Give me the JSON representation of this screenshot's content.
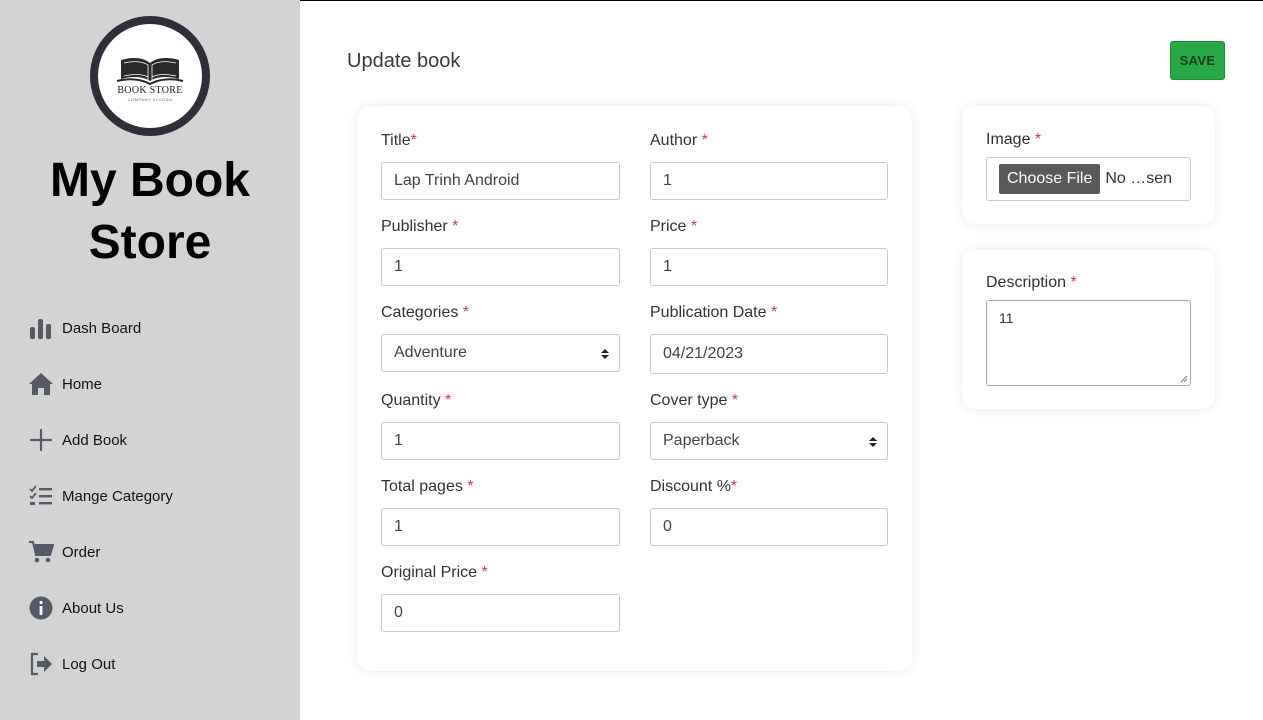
{
  "sidebar": {
    "logo": {
      "text": "BOOK STORE",
      "slogan": "COMPANY SLOGAN"
    },
    "brand": "My Book Store",
    "items": [
      {
        "label": "Dash Board",
        "icon": "bar-chart-icon"
      },
      {
        "label": "Home",
        "icon": "home-icon"
      },
      {
        "label": "Add Book",
        "icon": "plus-icon"
      },
      {
        "label": "Mange Category",
        "icon": "checklist-icon"
      },
      {
        "label": "Order",
        "icon": "cart-icon"
      },
      {
        "label": "About Us",
        "icon": "info-icon"
      },
      {
        "label": "Log Out",
        "icon": "logout-icon"
      }
    ]
  },
  "header": {
    "title": "Update book",
    "save_label": "SAVE"
  },
  "form": {
    "title": {
      "label": "Title",
      "value": "Lap Trinh Android"
    },
    "author": {
      "label": "Author ",
      "value": "1"
    },
    "publisher": {
      "label": "Publisher ",
      "value": "1"
    },
    "price": {
      "label": "Price ",
      "value": "1"
    },
    "categories": {
      "label": "Categories ",
      "value": "Adventure"
    },
    "publication_date": {
      "label": "Publication Date ",
      "value": "04/21/2023"
    },
    "quantity": {
      "label": "Quantity ",
      "value": "1"
    },
    "cover_type": {
      "label": "Cover type ",
      "value": "Paperback"
    },
    "total_pages": {
      "label": "Total pages ",
      "value": "1"
    },
    "discount": {
      "label": "Discount %",
      "value": "0"
    },
    "original_price": {
      "label": "Original Price ",
      "value": "0"
    },
    "required_mark": "*"
  },
  "image_card": {
    "label": "Image ",
    "button": "Choose File",
    "status": "No …sen"
  },
  "description_card": {
    "label": "Description ",
    "value": "11"
  },
  "colors": {
    "sidebar_bg": "#d3d3d3",
    "save_button": "#28a745",
    "required": "#dc3545",
    "icon": "#555a66"
  }
}
